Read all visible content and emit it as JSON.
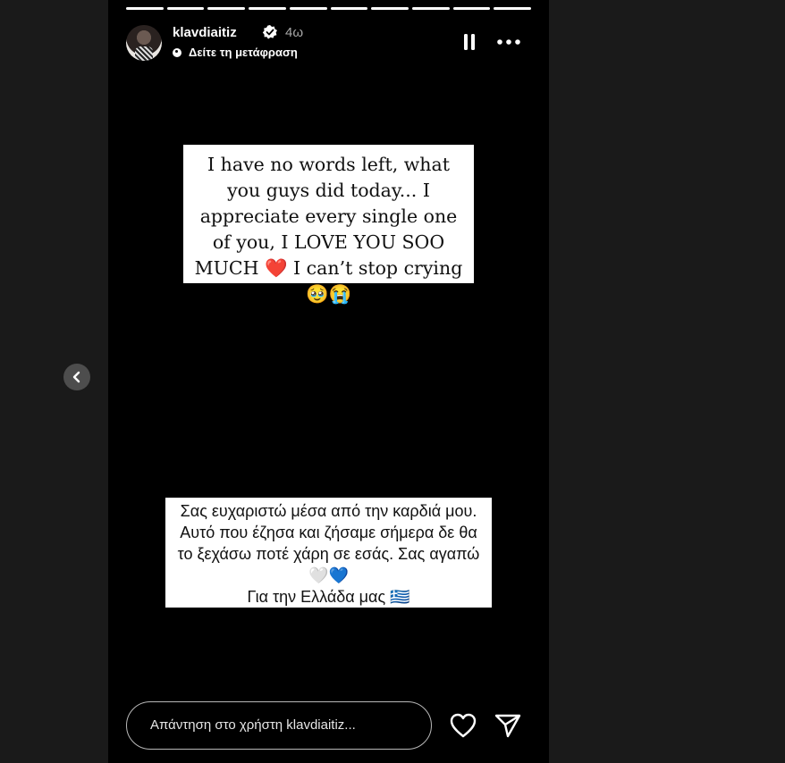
{
  "story": {
    "progress_segments": [
      1,
      1,
      1,
      1,
      1,
      1,
      1,
      1,
      1,
      1
    ],
    "username": "klavdiaitiz",
    "time": "4ω",
    "translate_label": "Δείτε τη μετάφραση",
    "text_card_1": "I have no words left, what you guys did today... I appreciate every single one of you, I LOVE YOU SOO MUCH ❤️ I can’t stop crying 🥹😭",
    "text_card_2": "Σας ευχαριστώ μέσα από την καρδιά μου. Αυτό που έζησα και ζήσαμε σήμερα δε θα το ξεχάσω ποτέ χάρη σε εσάς. Σας αγαπώ🤍💙\nΓια την Ελλάδα μας 🇬🇷",
    "reply_placeholder": "Απάντηση στο χρήστη klavdiaitiz...",
    "icons": [
      "chevron-left-icon",
      "verified-badge-icon",
      "globe-icon",
      "pause-icon",
      "more-icon",
      "heart-icon",
      "share-icon"
    ]
  },
  "colors": {
    "accent": "#ffffff",
    "background": "#000000",
    "page": "#1a1a1a",
    "muted": "#a8a8a8",
    "verified": "#ffffff"
  }
}
